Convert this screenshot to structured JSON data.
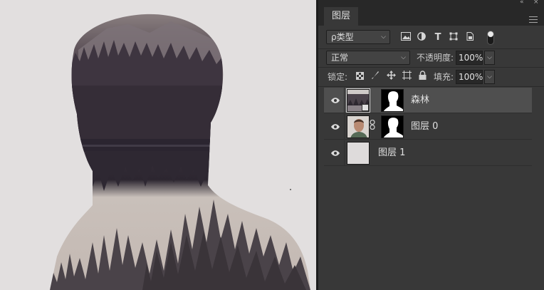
{
  "panel": {
    "tab_label": "图层",
    "collapse_glyph": "«",
    "close_glyph": "×"
  },
  "filter": {
    "kind_label": "ρ类型",
    "caret": "⌵",
    "icons": [
      "image-filter-icon",
      "adjustment-filter-icon",
      "type-filter-icon",
      "shape-filter-icon",
      "smart-object-filter-icon"
    ]
  },
  "blend": {
    "mode": "正常",
    "opacity_label": "不透明度:",
    "opacity_value": "100%"
  },
  "lock": {
    "label": "锁定:",
    "fill_label": "填充:",
    "fill_value": "100%",
    "icons": [
      "lock-transparent-icon",
      "lock-image-icon",
      "lock-position-icon",
      "lock-artboard-icon",
      "lock-all-icon"
    ]
  },
  "layers": [
    {
      "name": "森林",
      "selected": true,
      "has_mask": true,
      "type": "smart-object"
    },
    {
      "name": "图层 0",
      "selected": false,
      "has_mask": true,
      "type": "photo"
    },
    {
      "name": "图层 1",
      "selected": false,
      "has_mask": false,
      "type": "fill"
    }
  ],
  "colors": {
    "canvas_bg": "#e2dfdf",
    "panel_bg": "#383838",
    "selected_row": "#4f4f4f",
    "silhouette_dark": "#3a333a",
    "silhouette_light": "#b5aba6"
  }
}
